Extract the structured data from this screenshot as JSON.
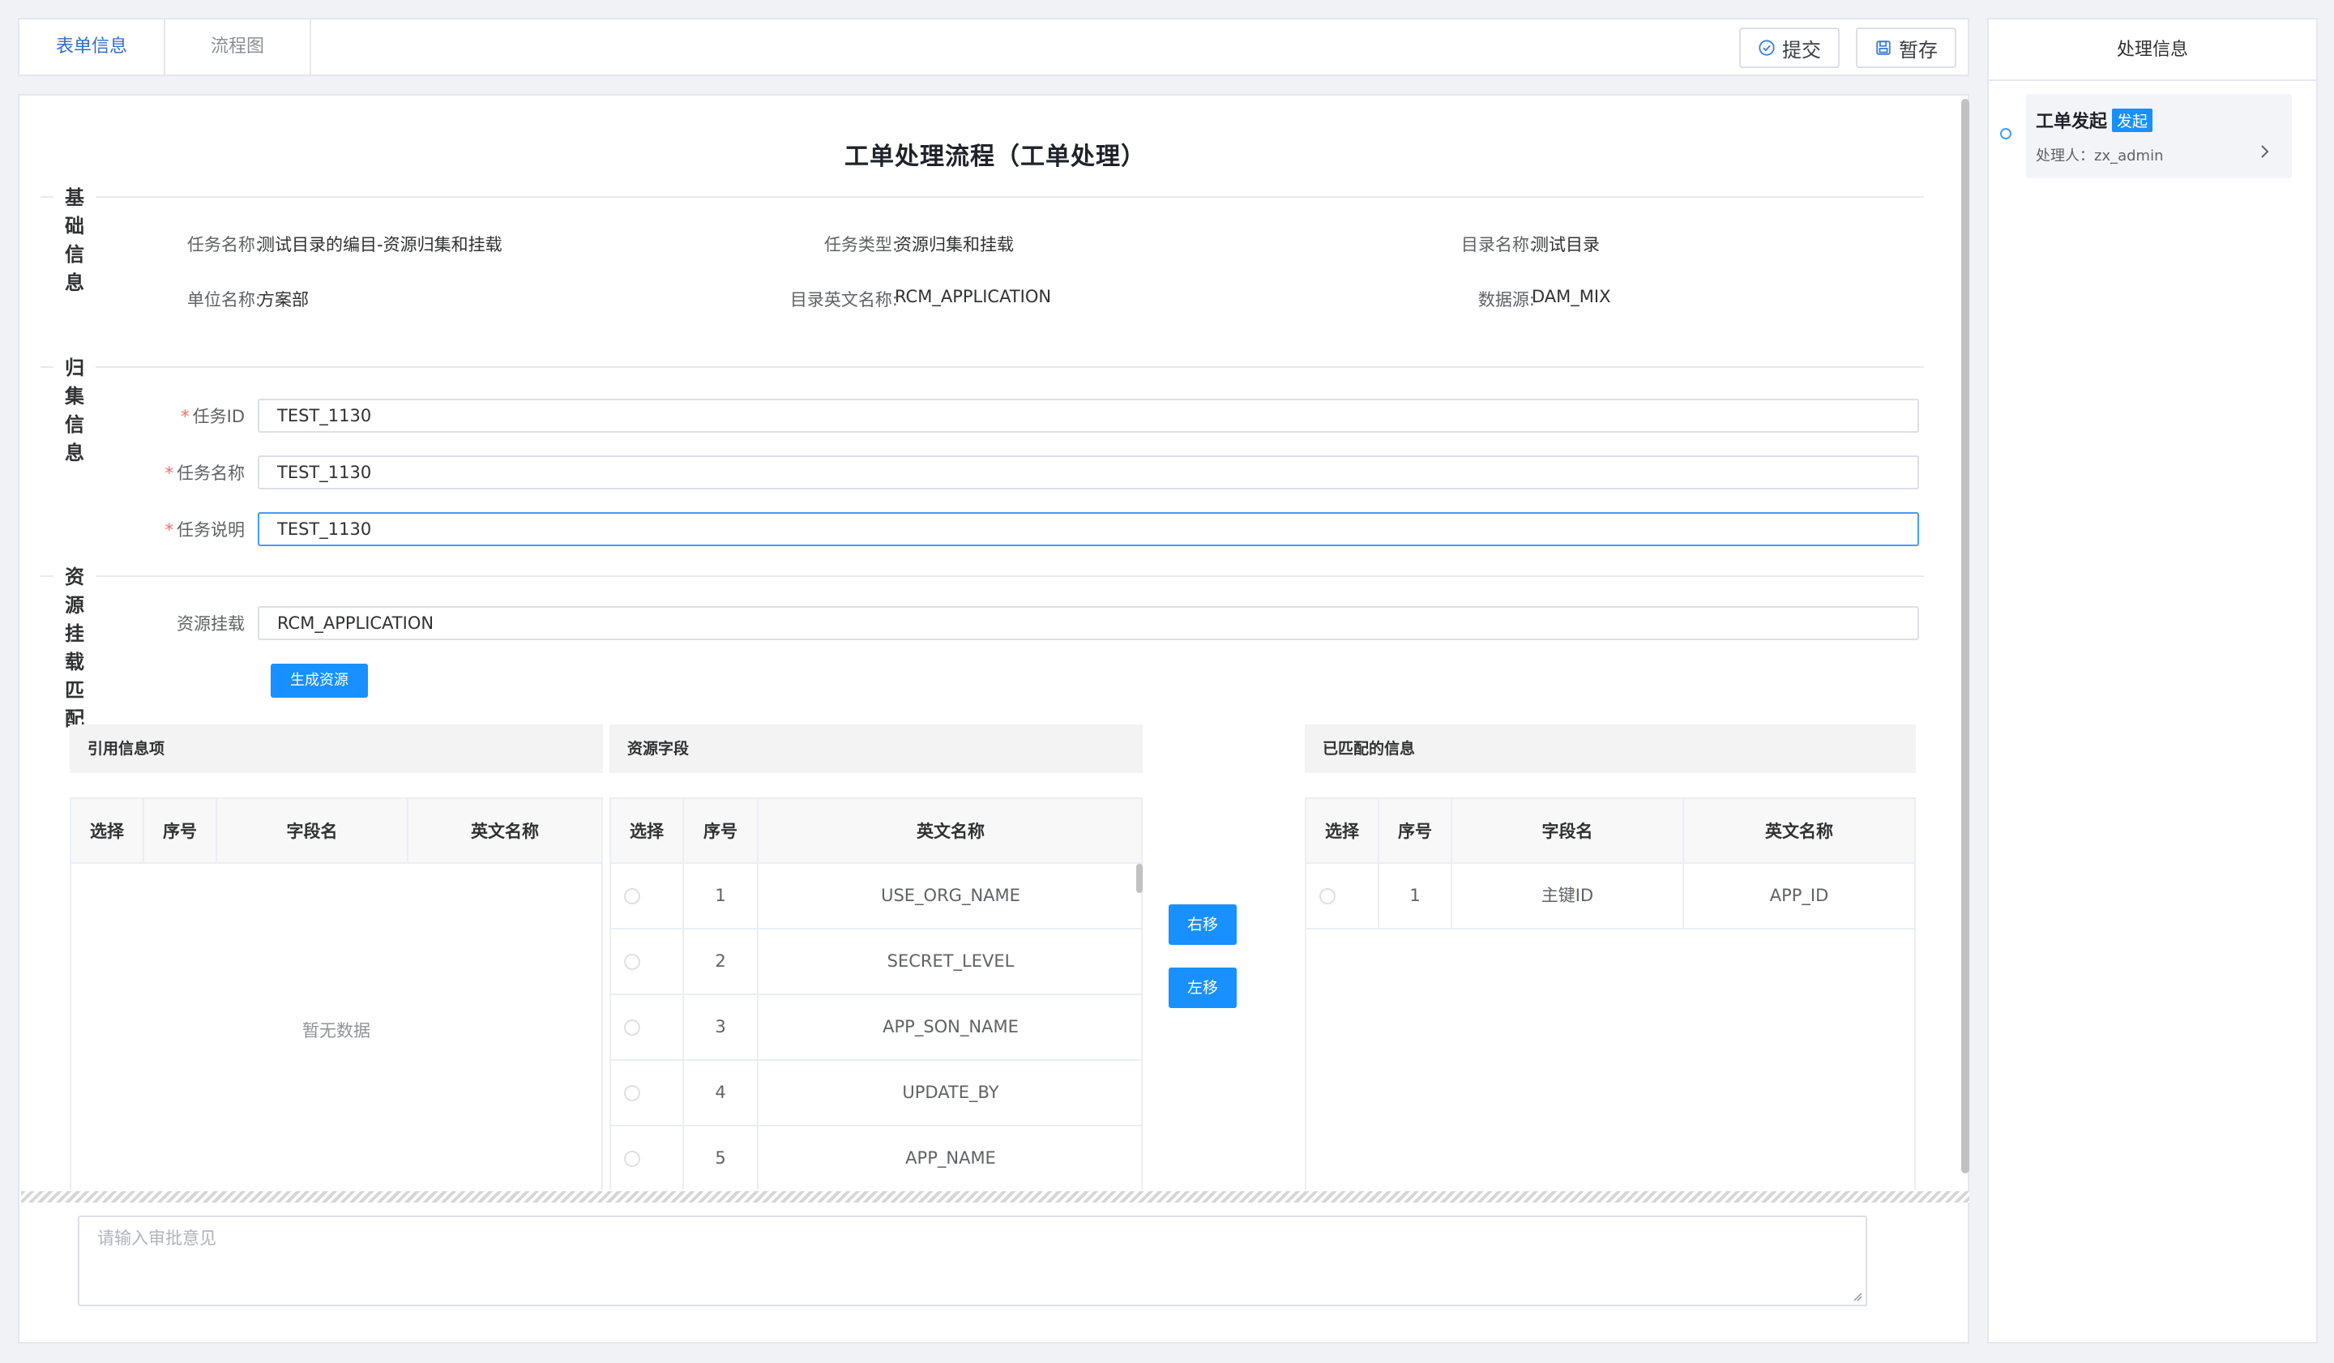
{
  "tabs": [
    {
      "label": "表单信息",
      "active": true
    },
    {
      "label": "流程图",
      "active": false
    }
  ],
  "toolbar": {
    "submit_label": "提交",
    "submit_icon": "check-circle-icon",
    "save_label": "暂存",
    "save_icon": "save-icon"
  },
  "side_panel": {
    "title": "处理信息",
    "timeline": [
      {
        "title": "工单发起",
        "tag": "发起",
        "handler": "处理人：zx_admin"
      }
    ]
  },
  "form": {
    "title": "工单处理流程（工单处理）",
    "basic": {
      "heading": "基础信息",
      "fields": [
        {
          "label": "任务名称:",
          "value": "测试目录的编目-资源归集和挂载"
        },
        {
          "label": "任务类型:",
          "value": "资源归集和挂载"
        },
        {
          "label": "目录名称:",
          "value": "测试目录"
        },
        {
          "label": "单位名称:",
          "value": "方案部"
        },
        {
          "label": "目录英文名称:",
          "value": "RCM_APPLICATION"
        },
        {
          "label": "数据源:",
          "value": "DAM_MIX"
        }
      ]
    },
    "collect": {
      "heading": "归集信息",
      "fields": [
        {
          "label": "任务ID",
          "value": "TEST_1130",
          "required": true
        },
        {
          "label": "任务名称",
          "value": "TEST_1130",
          "required": true
        },
        {
          "label": "任务说明",
          "value": "TEST_1130",
          "required": true
        }
      ]
    },
    "mount": {
      "heading": "资源挂载匹配",
      "label": "资源挂载",
      "value": "RCM_APPLICATION",
      "generate_button": "生成资源"
    }
  },
  "ref_table": {
    "title": "引用信息项",
    "columns": [
      "选择",
      "序号",
      "字段名",
      "英文名称"
    ],
    "empty_text": "暂无数据"
  },
  "resource_table": {
    "title": "资源字段",
    "columns": [
      "选择",
      "序号",
      "英文名称"
    ],
    "rows": [
      {
        "index": "1",
        "en_name": "USE_ORG_NAME"
      },
      {
        "index": "2",
        "en_name": "SECRET_LEVEL"
      },
      {
        "index": "3",
        "en_name": "APP_SON_NAME"
      },
      {
        "index": "4",
        "en_name": "UPDATE_BY"
      },
      {
        "index": "5",
        "en_name": "APP_NAME"
      }
    ]
  },
  "move": {
    "right_label": "右移",
    "left_label": "左移"
  },
  "matched_table": {
    "title": "已匹配的信息",
    "columns": [
      "选择",
      "序号",
      "字段名",
      "英文名称"
    ],
    "rows": [
      {
        "index": "1",
        "field_name": "主键ID",
        "en_name": "APP_ID"
      }
    ]
  },
  "comment": {
    "placeholder": "请输入审批意见"
  },
  "colors": {
    "primary": "#1890ff",
    "active_tab": "#2f6dcc",
    "required": "#f56c6c"
  }
}
